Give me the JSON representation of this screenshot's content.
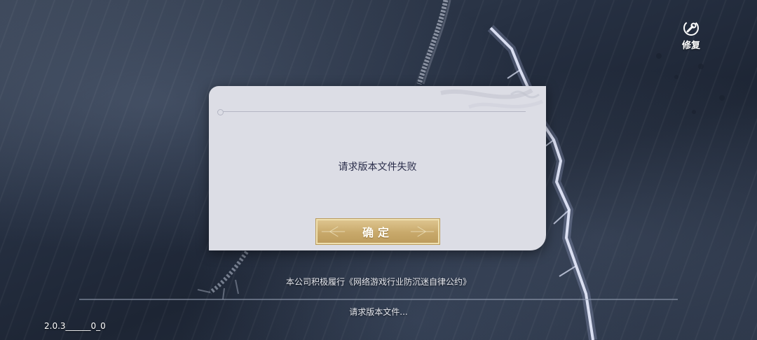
{
  "repair": {
    "label": "修复",
    "icon": "wrench-repair-icon"
  },
  "dialog": {
    "message": "请求版本文件失败",
    "confirm_label": "确定"
  },
  "footer": {
    "notice": "本公司积极履行《网络游戏行业防沉迷自律公约》",
    "status": "请求版本文件...",
    "progress": 0,
    "version": "2.0.3______0_0"
  },
  "colors": {
    "dialog_bg": "#dcdde5",
    "button_gold": "#c8a96b",
    "message_text": "#2a2d4a"
  }
}
